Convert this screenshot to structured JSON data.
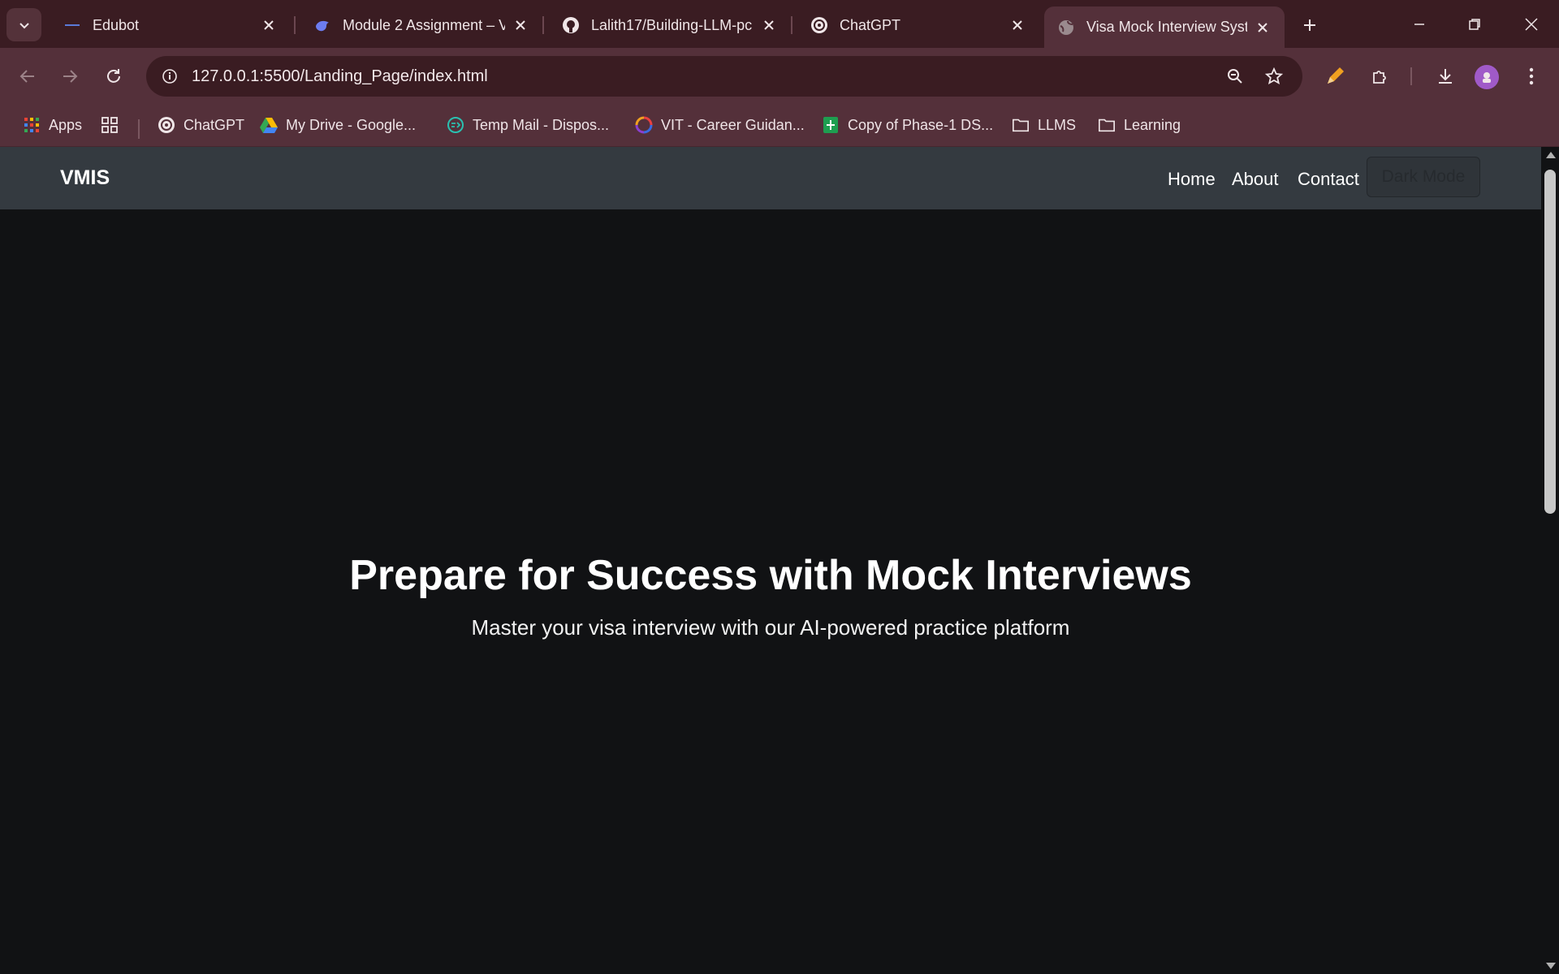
{
  "browser": {
    "tabs": [
      {
        "title": "Edubot",
        "icon": "edubot-icon"
      },
      {
        "title": "Module 2 Assignment – V",
        "icon": "deepseek-icon"
      },
      {
        "title": "Lalith17/Building-LLM-pc",
        "icon": "github-icon"
      },
      {
        "title": "ChatGPT",
        "icon": "chatgpt-icon"
      },
      {
        "title": "Visa Mock Interview Syste",
        "icon": "globe-icon",
        "active": true
      }
    ],
    "url": "127.0.0.1:5500/Landing_Page/index.html",
    "bookmarks": [
      {
        "label": "Apps",
        "icon": "apps-grid-icon"
      },
      {
        "label": "",
        "icon": "tab-groups-icon"
      },
      {
        "label": "ChatGPT",
        "icon": "chatgpt-icon"
      },
      {
        "label": "My Drive - Google...",
        "icon": "google-drive-icon"
      },
      {
        "label": "Temp Mail - Dispos...",
        "icon": "temp-mail-icon"
      },
      {
        "label": "VIT - Career Guidan...",
        "icon": "vit-icon"
      },
      {
        "label": "Copy of Phase-1 DS...",
        "icon": "sheets-icon"
      },
      {
        "label": "LLMS",
        "icon": "folder-icon"
      },
      {
        "label": "Learning",
        "icon": "folder-icon"
      }
    ],
    "colors": {
      "tabstrip": "#3a1c22",
      "toolbar": "#54303a"
    }
  },
  "site": {
    "brand": "VMIS",
    "nav": {
      "home": "Home",
      "about": "About",
      "contact": "Contact",
      "dark_mode": "Dark Mode"
    },
    "hero": {
      "title": "Prepare for Success with Mock Interviews",
      "subtitle": "Master your visa interview with our AI-powered practice platform"
    },
    "colors": {
      "navbar": "#343a40",
      "background": "#111214"
    }
  }
}
